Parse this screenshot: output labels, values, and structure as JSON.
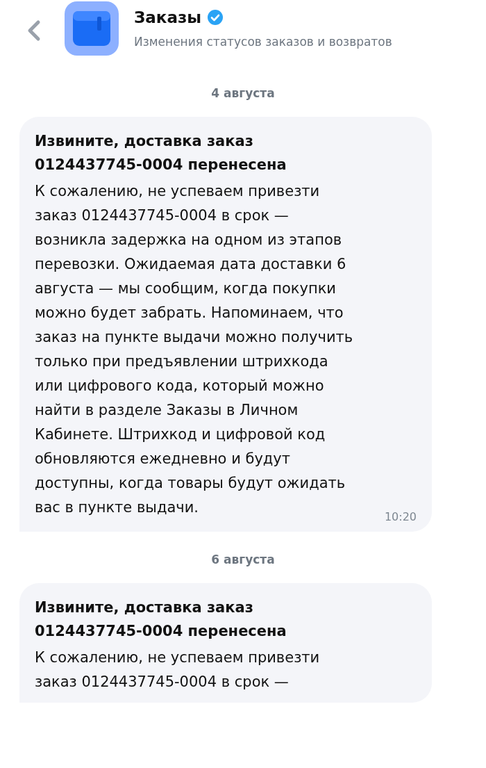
{
  "header": {
    "title": "Заказы",
    "verified": true,
    "subtitle": "Изменения статусов заказов и возвратов"
  },
  "feed": [
    {
      "kind": "date",
      "text": "4 августа"
    },
    {
      "kind": "message",
      "title": "Извините, доставка заказ 0124437745-0004 перенесена",
      "body": "К сожалению, не успеваем привезти заказ 0124437745-0004 в срок — возникла задержка на одном из этапов перевозки. Ожидаемая дата доставки 6 августа — мы сообщим, когда покупки можно будет забрать. Напоминаем, что заказ на пункте выдачи можно получить только при предъявлении штрихкода или цифрового кода, который можно найти в разделе Заказы в Личном Кабинете. Штрихкод и цифровой код обновляются ежедневно и будут доступны, когда товары будут ожидать вас в пункте выдачи.",
      "time": "10:20"
    },
    {
      "kind": "date",
      "text": "6 августа"
    },
    {
      "kind": "message",
      "title": "Извините, доставка заказ 0124437745-0004 перенесена",
      "body": "К сожалению, не успеваем привезти заказ 0124437745-0004 в срок —"
    }
  ]
}
